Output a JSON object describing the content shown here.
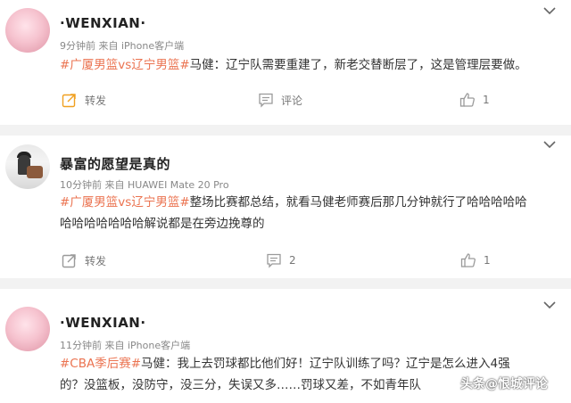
{
  "posts": [
    {
      "username": "·WENXIAN·",
      "meta": "9分钟前  来自 iPhone客户端",
      "tag": "#广厦男篮vs辽宁男篮#",
      "text_line1": "马健：辽宁队需要重建了，新老交替断层了，这是管理层要做。",
      "text_line2": "",
      "share_label": "转发",
      "comment_label": "评论",
      "like_count": "1"
    },
    {
      "username": "暴富的愿望是真的",
      "meta": "10分钟前  来自 HUAWEI Mate 20 Pro",
      "tag": "#广厦男篮vs辽宁男篮#",
      "text_line1": "整场比赛都总结，就看马健老师赛后那几分钟就行了哈哈哈哈哈",
      "text_line2": "哈哈哈哈哈哈哈解说都是在旁边挽尊的",
      "share_label": "转发",
      "comment_label": "2",
      "like_count": "1"
    },
    {
      "username": "·WENXIAN·",
      "meta": "11分钟前  来自 iPhone客户端",
      "tag": "#CBA季后赛#",
      "text_line1": "马健：我上去罚球都比他们好！辽宁队训练了吗？辽宁是怎么进入4强",
      "text_line2": "的？没篮板，没防守，没三分，失误又多……罚球又差，不如青年队"
    }
  ],
  "watermark": "头条@恨城评论",
  "colors": {
    "tag": "#eb7350",
    "share_active": "#f0a020",
    "icon_gray": "#9a9a9a"
  }
}
